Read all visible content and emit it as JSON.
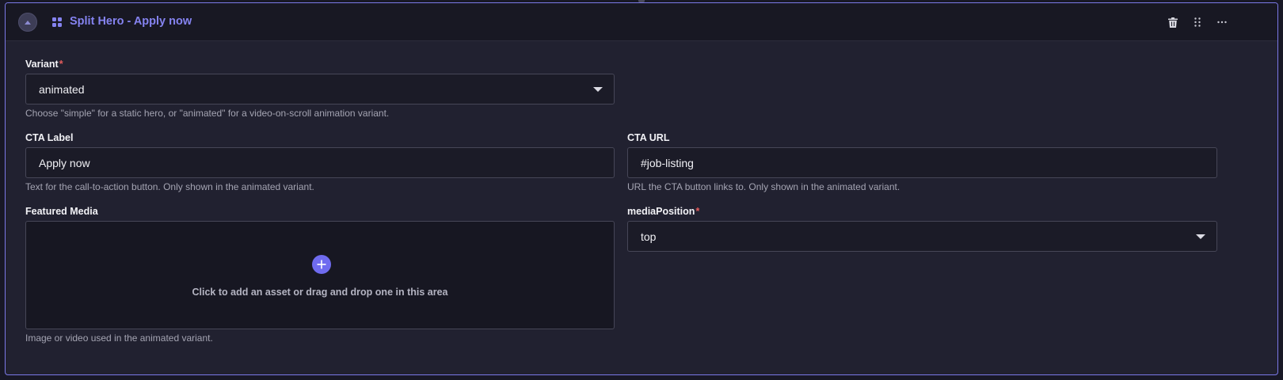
{
  "block": {
    "title": "Split Hero - Apply now",
    "icons": {
      "collapse": "chevron-up-icon",
      "block": "grid-blocks-icon",
      "delete": "trash-icon",
      "drag": "drag-handle-icon",
      "more": "more-horizontal-icon"
    }
  },
  "fields": {
    "variant": {
      "label": "Variant",
      "required_mark": "*",
      "value": "animated",
      "hint": "Choose \"simple\" for a static hero, or \"animated\" for a video-on-scroll animation variant."
    },
    "cta_label": {
      "label": "CTA Label",
      "value": "Apply now",
      "hint": "Text for the call-to-action button. Only shown in the animated variant."
    },
    "cta_url": {
      "label": "CTA URL",
      "value": "#job-listing",
      "hint": "URL the CTA button links to. Only shown in the animated variant."
    },
    "featured_media": {
      "label": "Featured Media",
      "dropzone_text": "Click to add an asset or drag and drop one in this area",
      "hint": "Image or video used in the animated variant."
    },
    "media_position": {
      "label": "mediaPosition",
      "required_mark": "*",
      "value": "top"
    }
  },
  "colors": {
    "accent": "#7b79e8",
    "title": "#8583f0",
    "required": "#e45c5c",
    "background": "#212130"
  }
}
